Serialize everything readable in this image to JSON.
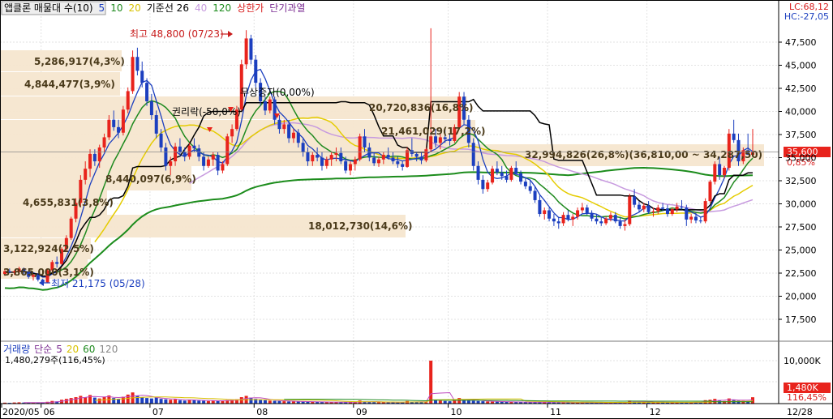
{
  "header": {
    "legend_items": [
      {
        "label": "앱클론 매물대 수(10)",
        "color": "#000000"
      },
      {
        "label": "5",
        "color": "#1c3fbf"
      },
      {
        "label": "10",
        "color": "#1f8a1f"
      },
      {
        "label": "20",
        "color": "#d8c200"
      },
      {
        "label": "기준선 26",
        "color": "#000000"
      },
      {
        "label": "40",
        "color": "#c79adf"
      },
      {
        "label": "120",
        "color": "#1c8c1c"
      },
      {
        "label": "상한가",
        "color": "#d81c1c"
      },
      {
        "label": "단기과열",
        "color": "#7a2a90"
      }
    ],
    "lc_label": "LC:68,12",
    "hc_label": "HC:-27,05"
  },
  "price_axis": {
    "ticks": [
      "47,500",
      "45,000",
      "42,500",
      "40,000",
      "37,500",
      "35,000",
      "32,500",
      "30,000",
      "27,500",
      "25,000",
      "22,500",
      "20,000",
      "17,500"
    ],
    "current_price": "35,600",
    "current_change": "0,85%"
  },
  "volume_axis": {
    "tick": "10,000K",
    "current_volume": "1,480K",
    "current_change": "116,45%"
  },
  "volume_panel": {
    "legend_items": [
      {
        "label": "거래량",
        "color": "#1c3fbf"
      },
      {
        "label": "단순",
        "color": "#7a2a90"
      },
      {
        "label": "5",
        "color": "#7a2a90"
      },
      {
        "label": "20",
        "color": "#d8c200"
      },
      {
        "label": "60",
        "color": "#1f8a1f"
      },
      {
        "label": "120",
        "color": "#888888"
      }
    ],
    "volume_text": "1,480,279주(116,45%)"
  },
  "x_axis": {
    "labels": [
      "2020/05",
      "06",
      "07",
      "08",
      "09",
      "10",
      "11",
      "12",
      "12/28"
    ]
  },
  "annotations": {
    "high": "최고 48,800 (07/23)",
    "low": "최저 21,175 (05/28)",
    "rights_drop": "권리락(-50,0%)",
    "bonus_issue": "무상증자(0,00%)"
  },
  "volume_profile": [
    {
      "label": "5,286,917(4,3%)"
    },
    {
      "label": "4,844,477(3,9%)"
    },
    {
      "label": "20,720,836(16,8%)"
    },
    {
      "label": "21,461,029(17,2%)"
    },
    {
      "label": "32,994,826(26,8%)(36,810,00 ~ 34,287,50)"
    },
    {
      "label": "8,440,097(6,9%)"
    },
    {
      "label": "4,655,831(3,8%)"
    },
    {
      "label": "18,012,730(14,6%)"
    },
    {
      "label": "3,122,924(2,5%)"
    },
    {
      "label": "3,865,000(3,1%)"
    }
  ],
  "chart_data": {
    "type": "candlestick",
    "title": "앱클론 매물대 수(10)",
    "x_labels": [
      "2020/05",
      "06",
      "07",
      "08",
      "09",
      "10",
      "11",
      "12",
      "12/28"
    ],
    "ylim": [
      15000,
      50000
    ],
    "volume_ylim_k": [
      0,
      12000
    ],
    "grid": true,
    "candles": [
      [
        22400,
        22900,
        22200,
        22700
      ],
      [
        22700,
        23000,
        22500,
        22600
      ],
      [
        22600,
        22800,
        22300,
        22700
      ],
      [
        22700,
        23200,
        22500,
        23000
      ],
      [
        23000,
        23100,
        22400,
        22600
      ],
      [
        22600,
        22700,
        21900,
        22100
      ],
      [
        22100,
        22400,
        21700,
        22300
      ],
      [
        22300,
        22500,
        21600,
        21800
      ],
      [
        21800,
        21900,
        21175,
        21500
      ],
      [
        21500,
        22900,
        21400,
        22800
      ],
      [
        22800,
        23900,
        22600,
        23700
      ],
      [
        23700,
        24300,
        23100,
        23500
      ],
      [
        23500,
        25300,
        23400,
        25100
      ],
      [
        25100,
        26600,
        24900,
        26300
      ],
      [
        26300,
        28600,
        26100,
        28400
      ],
      [
        28400,
        30600,
        28000,
        30100
      ],
      [
        30100,
        33100,
        29700,
        32600
      ],
      [
        32600,
        34600,
        32100,
        33800
      ],
      [
        33800,
        35900,
        32900,
        35400
      ],
      [
        35400,
        35900,
        34100,
        34600
      ],
      [
        34600,
        36400,
        33900,
        36100
      ],
      [
        36100,
        37600,
        35600,
        37200
      ],
      [
        37200,
        39600,
        36900,
        39100
      ],
      [
        39100,
        40100,
        37900,
        38300
      ],
      [
        38300,
        39100,
        37100,
        37700
      ],
      [
        37700,
        40600,
        37400,
        40200
      ],
      [
        40200,
        42600,
        39800,
        42200
      ],
      [
        42200,
        46600,
        41900,
        45900
      ],
      [
        45900,
        46900,
        43900,
        44400
      ],
      [
        44400,
        45400,
        42600,
        43100
      ],
      [
        43100,
        43600,
        40600,
        41100
      ],
      [
        41100,
        41900,
        39100,
        39600
      ],
      [
        39600,
        40100,
        37100,
        37600
      ],
      [
        37600,
        38100,
        35600,
        36100
      ],
      [
        36100,
        36600,
        33600,
        34100
      ],
      [
        34100,
        35100,
        33100,
        34600
      ],
      [
        34600,
        36600,
        34100,
        36200
      ],
      [
        36200,
        37100,
        35100,
        35600
      ],
      [
        35600,
        36100,
        34600,
        35100
      ],
      [
        35100,
        36600,
        34800,
        36300
      ],
      [
        36300,
        37100,
        35600,
        36000
      ],
      [
        36000,
        36400,
        34600,
        35100
      ],
      [
        35100,
        35600,
        33600,
        34100
      ],
      [
        34100,
        35100,
        33900,
        34800
      ],
      [
        34800,
        35600,
        34100,
        35300
      ],
      [
        35300,
        35600,
        33100,
        33600
      ],
      [
        33600,
        34600,
        33300,
        34300
      ],
      [
        34300,
        37600,
        34100,
        37300
      ],
      [
        37300,
        38600,
        36600,
        38100
      ],
      [
        38100,
        40600,
        37900,
        40200
      ],
      [
        40200,
        45600,
        40100,
        45100
      ],
      [
        45100,
        48800,
        44600,
        47900
      ],
      [
        47900,
        48300,
        45100,
        45600
      ],
      [
        45600,
        46100,
        42600,
        43100
      ],
      [
        43100,
        43600,
        40600,
        41100
      ],
      [
        41100,
        41600,
        39600,
        40100
      ],
      [
        40100,
        41600,
        39800,
        41300
      ],
      [
        41300,
        41600,
        38600,
        39100
      ],
      [
        39100,
        39600,
        37600,
        38100
      ],
      [
        38100,
        39100,
        37600,
        38600
      ],
      [
        38600,
        39100,
        36600,
        37100
      ],
      [
        37100,
        38100,
        36600,
        37700
      ],
      [
        37700,
        38100,
        36100,
        36600
      ],
      [
        36600,
        37100,
        35100,
        35600
      ],
      [
        35600,
        36100,
        34100,
        34600
      ],
      [
        34600,
        35600,
        34100,
        35300
      ],
      [
        35300,
        36100,
        34600,
        35000
      ],
      [
        35000,
        35600,
        33600,
        34100
      ],
      [
        34100,
        35100,
        33800,
        34800
      ],
      [
        34800,
        35600,
        34100,
        35300
      ],
      [
        35300,
        36100,
        34600,
        35500
      ],
      [
        35500,
        36100,
        34300,
        34600
      ],
      [
        34600,
        35100,
        33300,
        33600
      ],
      [
        33600,
        34600,
        33100,
        34300
      ],
      [
        34300,
        35100,
        33600,
        34800
      ],
      [
        34800,
        37600,
        34600,
        37300
      ],
      [
        37300,
        38100,
        35600,
        36100
      ],
      [
        36100,
        36600,
        34600,
        35000
      ],
      [
        35000,
        35600,
        34100,
        34400
      ],
      [
        34400,
        35100,
        34000,
        34800
      ],
      [
        34800,
        35600,
        34300,
        35300
      ],
      [
        35300,
        36100,
        34800,
        35000
      ],
      [
        35000,
        35600,
        34300,
        34600
      ],
      [
        34600,
        35100,
        33900,
        34300
      ],
      [
        34300,
        34600,
        33600,
        34000
      ],
      [
        34000,
        36100,
        33900,
        35800
      ],
      [
        35800,
        37100,
        35100,
        35400
      ],
      [
        35400,
        35600,
        34600,
        35100
      ],
      [
        35100,
        35600,
        34300,
        34700
      ],
      [
        34700,
        36100,
        34500,
        35900
      ],
      [
        35900,
        49000,
        35600,
        37300
      ],
      [
        37300,
        38100,
        36100,
        36600
      ],
      [
        36600,
        37600,
        35900,
        37200
      ],
      [
        37200,
        38100,
        36600,
        37000
      ],
      [
        37000,
        37600,
        36300,
        36800
      ],
      [
        36800,
        38600,
        36600,
        38300
      ],
      [
        38300,
        42100,
        38100,
        41600
      ],
      [
        41600,
        42100,
        38600,
        39100
      ],
      [
        39100,
        39600,
        36100,
        36600
      ],
      [
        36600,
        37100,
        33600,
        34100
      ],
      [
        34100,
        34600,
        32100,
        32600
      ],
      [
        32600,
        33100,
        31100,
        31600
      ],
      [
        31600,
        32600,
        31300,
        32300
      ],
      [
        32300,
        34100,
        32100,
        33800
      ],
      [
        33800,
        34600,
        33100,
        33400
      ],
      [
        33400,
        34100,
        32600,
        33000
      ],
      [
        33000,
        33600,
        32300,
        32600
      ],
      [
        32600,
        34100,
        32400,
        33900
      ],
      [
        33900,
        34600,
        33100,
        33300
      ],
      [
        33300,
        33600,
        32100,
        32400
      ],
      [
        32400,
        32900,
        31600,
        31900
      ],
      [
        31900,
        32600,
        31100,
        31400
      ],
      [
        31400,
        31900,
        30100,
        30400
      ],
      [
        30400,
        30900,
        28600,
        28900
      ],
      [
        28900,
        29600,
        28300,
        29300
      ],
      [
        29300,
        29600,
        28100,
        28400
      ],
      [
        28400,
        28900,
        27600,
        28100
      ],
      [
        28100,
        28600,
        27300,
        27900
      ],
      [
        27900,
        29100,
        27600,
        28800
      ],
      [
        28800,
        29300,
        28100,
        28300
      ],
      [
        28300,
        28900,
        27600,
        28600
      ],
      [
        28600,
        29600,
        28300,
        29300
      ],
      [
        29300,
        30100,
        29000,
        29600
      ],
      [
        29600,
        29900,
        28800,
        29000
      ],
      [
        29000,
        29300,
        28100,
        28400
      ],
      [
        28400,
        28900,
        27800,
        28100
      ],
      [
        28100,
        28600,
        27600,
        27900
      ],
      [
        27900,
        28600,
        27700,
        28400
      ],
      [
        28400,
        29100,
        28100,
        28800
      ],
      [
        28800,
        29100,
        27900,
        28100
      ],
      [
        28100,
        28600,
        27300,
        27600
      ],
      [
        27600,
        28300,
        27100,
        27800
      ],
      [
        27800,
        31100,
        27600,
        30800
      ],
      [
        30800,
        31600,
        29600,
        29900
      ],
      [
        29900,
        30300,
        29100,
        29400
      ],
      [
        29400,
        30100,
        29100,
        29800
      ],
      [
        29800,
        30300,
        28900,
        29100
      ],
      [
        29100,
        29600,
        28600,
        29200
      ],
      [
        29200,
        29900,
        28900,
        29600
      ],
      [
        29600,
        30100,
        29200,
        29500
      ],
      [
        29500,
        29900,
        28600,
        28900
      ],
      [
        28900,
        29600,
        28700,
        29400
      ],
      [
        29400,
        30100,
        29100,
        29700
      ],
      [
        29700,
        30400,
        29400,
        29600
      ],
      [
        29600,
        29900,
        27600,
        28300
      ],
      [
        28300,
        28900,
        27900,
        28600
      ],
      [
        28600,
        29100,
        27900,
        28200
      ],
      [
        28200,
        28600,
        27900,
        28100
      ],
      [
        28100,
        30600,
        27900,
        30300
      ],
      [
        30300,
        32600,
        30100,
        32400
      ],
      [
        32400,
        34600,
        32100,
        34300
      ],
      [
        34300,
        35100,
        32600,
        33100
      ],
      [
        33100,
        34100,
        32800,
        33900
      ],
      [
        33900,
        38100,
        33600,
        37600
      ],
      [
        37600,
        39100,
        36600,
        36900
      ],
      [
        36900,
        37600,
        34100,
        34600
      ],
      [
        34600,
        36100,
        34300,
        35800
      ],
      [
        35800,
        37600,
        35300,
        35300
      ],
      [
        35300,
        38100,
        35100,
        35600
      ]
    ],
    "volume_k": [
      220,
      180,
      260,
      300,
      240,
      200,
      180,
      220,
      260,
      420,
      620,
      520,
      900,
      1100,
      1300,
      1500,
      1800,
      1500,
      2000,
      1400,
      1200,
      1600,
      1900,
      1300,
      1100,
      1600,
      2100,
      2600,
      1800,
      1500,
      1300,
      1200,
      1400,
      1100,
      1000,
      900,
      1000,
      800,
      700,
      900,
      850,
      700,
      650,
      600,
      700,
      650,
      700,
      800,
      900,
      1000,
      1500,
      1800,
      1400,
      1100,
      900,
      800,
      700,
      650,
      600,
      550,
      500,
      520,
      480,
      450,
      420,
      400,
      380,
      360,
      350,
      340,
      330,
      320,
      310,
      300,
      300,
      700,
      500,
      400,
      350,
      330,
      320,
      310,
      300,
      290,
      280,
      600,
      450,
      380,
      330,
      300,
      10000,
      900,
      700,
      600,
      550,
      800,
      1300,
      900,
      700,
      650,
      600,
      550,
      500,
      450,
      450,
      420,
      400,
      380,
      360,
      340,
      330,
      320,
      320,
      340,
      330,
      320,
      310,
      300,
      290,
      280,
      270,
      260,
      260,
      250,
      250,
      240,
      240,
      230,
      230,
      220,
      230,
      220,
      700,
      450,
      380,
      350,
      330,
      320,
      310,
      300,
      290,
      280,
      280,
      270,
      300,
      290,
      280,
      270,
      800,
      900,
      1100,
      700,
      600,
      1200,
      900,
      700,
      650,
      600,
      1480
    ],
    "high_label": "최고 48,800 (07/23)",
    "low_label": "최저 21,175 (05/28)",
    "current_price": 35600
  }
}
